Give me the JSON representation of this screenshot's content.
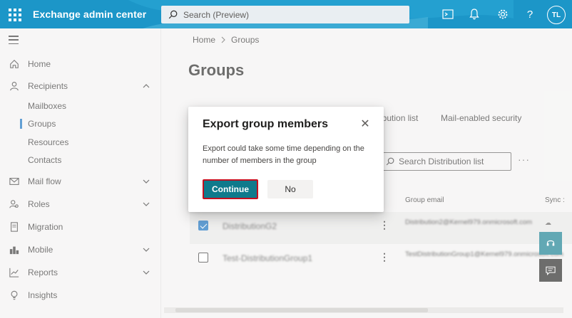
{
  "header": {
    "app_title": "Exchange admin center",
    "search_placeholder": "Search (Preview)",
    "avatar_initials": "TL"
  },
  "sidebar": {
    "items": [
      {
        "label": "Home",
        "icon": "home-icon"
      },
      {
        "label": "Recipients",
        "icon": "person-icon"
      },
      {
        "label": "Mail flow",
        "icon": "mail-icon"
      },
      {
        "label": "Roles",
        "icon": "roles-icon"
      },
      {
        "label": "Migration",
        "icon": "migration-icon"
      },
      {
        "label": "Mobile",
        "icon": "mobile-icon"
      },
      {
        "label": "Reports",
        "icon": "reports-icon"
      },
      {
        "label": "Insights",
        "icon": "insights-icon"
      }
    ],
    "recipients_sub": [
      "Mailboxes",
      "Groups",
      "Resources",
      "Contacts"
    ]
  },
  "breadcrumb": {
    "home": "Home",
    "current": "Groups"
  },
  "page_title": "Groups",
  "tabs": [
    "ibution list",
    "Mail-enabled security"
  ],
  "search_dl_placeholder": "Search Distribution list",
  "table": {
    "columns": {
      "group_email": "Group email",
      "sync": "Sync :"
    },
    "rows": [
      {
        "name": "DistributionG2",
        "email": "Distribution2@Kernel979.onmicrosoft.com",
        "selected": true
      },
      {
        "name": "Test-DistributionGroup1",
        "email": "TestDistributionGroup1@Kernel979.onmicrosoft.com",
        "selected": false
      }
    ]
  },
  "dialog": {
    "title": "Export group members",
    "body": "Export could take some time depending on the number of members in the group",
    "continue_label": "Continue",
    "no_label": "No"
  },
  "colors": {
    "header_bg": "#1c96c8",
    "accent": "#0f7a8c",
    "focus_border": "#c50f1f"
  }
}
